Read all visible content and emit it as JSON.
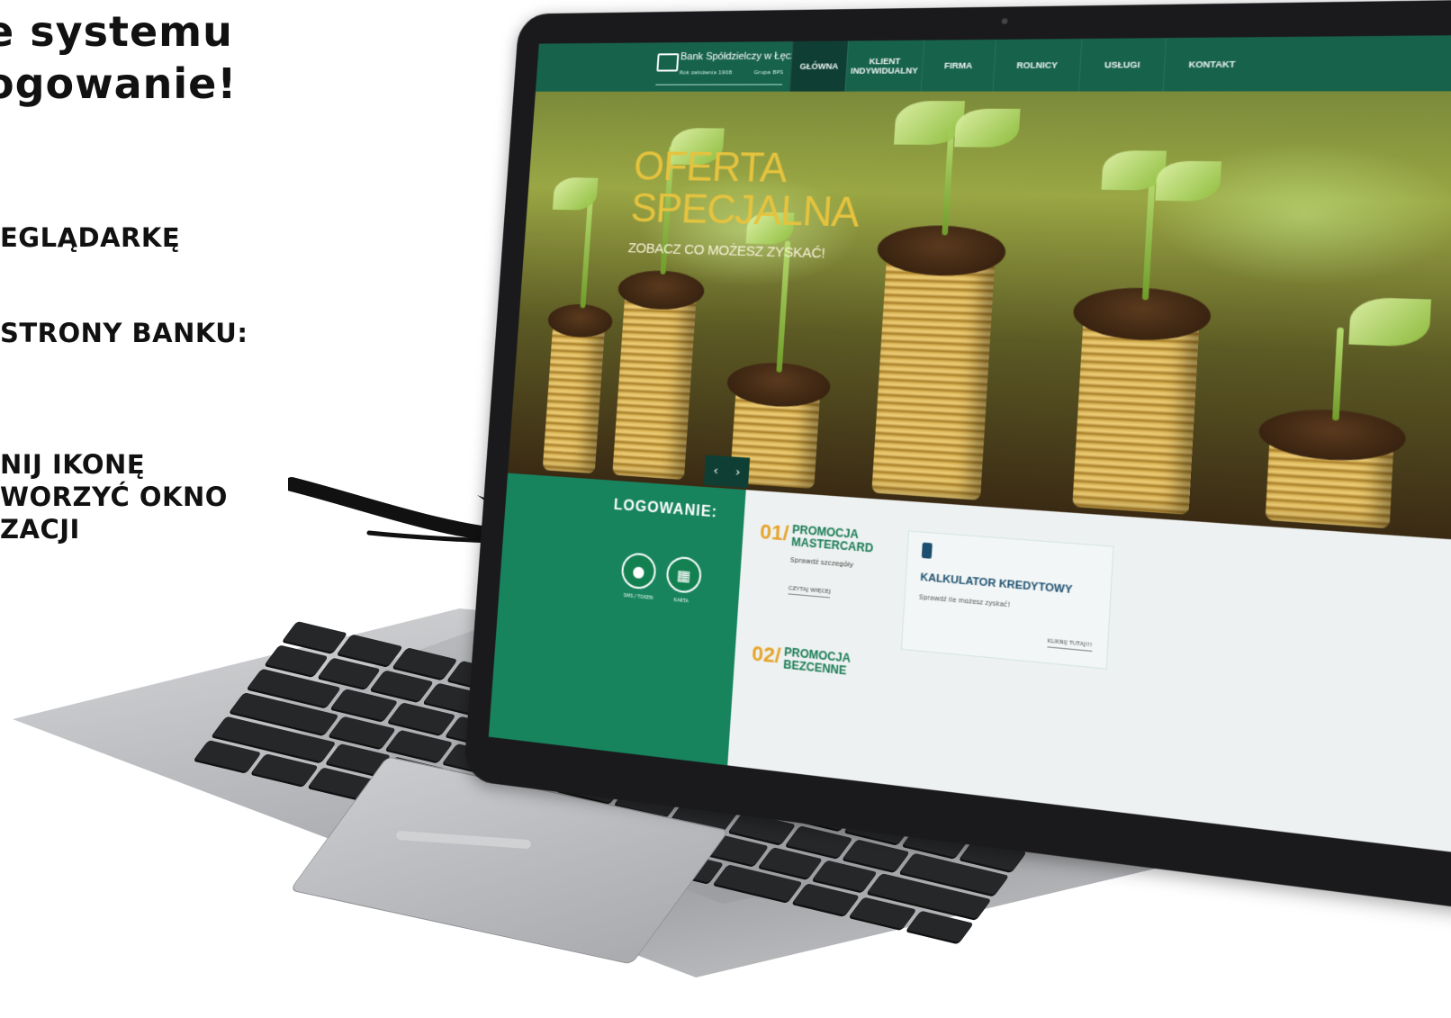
{
  "instructions": {
    "heading_line1": "e systemu",
    "heading_line2": "ogowanie!",
    "step1": "EGLĄDARKĘ",
    "step2": "STRONY BANKU:",
    "step3_line1": "NIJ IKONĘ",
    "step3_line2": "WORZYĆ OKNO",
    "step3_line3": "ZACJI"
  },
  "site": {
    "logo": {
      "name": "Bank Spółdzielczy w Łęcznej",
      "tagline": "Rok założenia 1908",
      "group": "Grupa BPS"
    },
    "nav": [
      {
        "label": "GŁÓWNA",
        "active": true
      },
      {
        "label": "KLIENT INDYWIDUALNY",
        "active": false
      },
      {
        "label": "FIRMA",
        "active": false
      },
      {
        "label": "ROLNICY",
        "active": false
      },
      {
        "label": "USŁUGI",
        "active": false
      },
      {
        "label": "KONTAKT",
        "active": false
      }
    ],
    "hero": {
      "title_line1": "OFERTA",
      "title_line2": "SPECJALNA",
      "subtitle": "ZOBACZ CO MOŻESZ ZYSKAĆ!",
      "prev": "‹",
      "next": "›"
    },
    "login": {
      "title": "LOGOWANIE:",
      "button1_label": "SMS / TOKEN",
      "button2_label": "KARTA"
    },
    "promos": [
      {
        "number": "01/",
        "title_line1": "PROMOCJA",
        "title_line2": "MASTERCARD",
        "text": "Sprawdź szczegóły",
        "more": "CZYTAJ WIĘCEJ"
      },
      {
        "number": "02/",
        "title_line1": "PROMOCJA",
        "title_line2": "BEZCENNE"
      }
    ],
    "calculator": {
      "title": "KALKULATOR KREDYTOWY",
      "text": "Sprawdź ile możesz zyskać!",
      "link": "KLIKNIJ TUTAJ!!!"
    }
  },
  "colors": {
    "brand_green": "#17624b",
    "login_green": "#17845e",
    "accent_orange": "#e5a42a",
    "hero_gold": "#e5c33e"
  }
}
